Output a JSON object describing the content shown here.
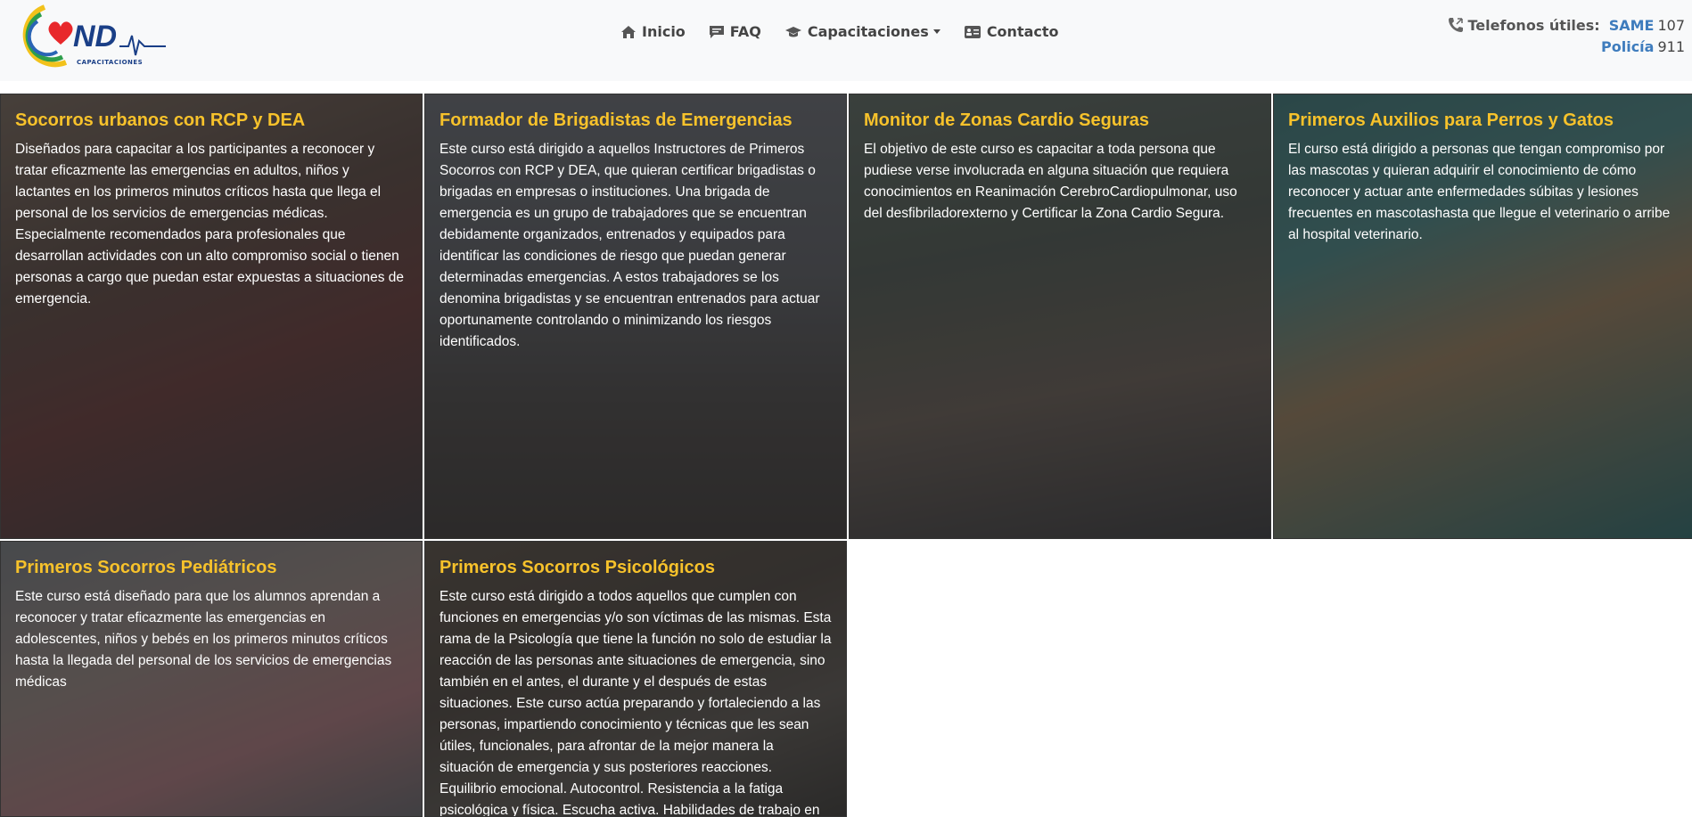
{
  "header": {
    "logo_text": "ND",
    "logo_subtext": "CAPACITACIONES",
    "nav": [
      {
        "label": "Inicio",
        "icon": "home-icon"
      },
      {
        "label": "FAQ",
        "icon": "comment-icon"
      },
      {
        "label": "Capacitaciones",
        "icon": "graduation-cap-icon"
      },
      {
        "label": "Contacto",
        "icon": "contact-card-icon"
      }
    ],
    "phones": {
      "label": "Telefonos útiles:",
      "icon": "phone-icon",
      "items": [
        {
          "service": "SAME",
          "number": "107"
        },
        {
          "service": "Policía",
          "number": "911"
        }
      ]
    }
  },
  "courses": [
    {
      "title": "Socorros urbanos con RCP y DEA",
      "text": "Diseñados para capacitar a los participantes a reconocer y tratar eficazmente las emergencias en adultos, niños y lactantes en los primeros minutos críticos hasta que llega el personal de los servicios de emergencias médicas. Especialmente recomendados para profesionales que desarrollan actividades con un alto compromiso social o tienen personas a cargo que puedan estar expuestas a situaciones de emergencia."
    },
    {
      "title": "Formador de Brigadistas de Emergencias",
      "text": "Este curso está dirigido a aquellos Instructores de Primeros Socorros con RCP y DEA, que quieran certificar brigadistas o brigadas en empresas o instituciones. Una brigada de emergencia es un grupo de trabajadores que se encuentran debidamente organizados, entrenados y equipados para identificar las condiciones de riesgo que puedan generar determinadas emergencias. A estos trabajadores se los denomina brigadistas y se encuentran entrenados para actuar oportunamente controlando o minimizando los riesgos identificados."
    },
    {
      "title": "Monitor de Zonas Cardio Seguras",
      "text": "El objetivo de este curso es capacitar a toda persona que pudiese verse involucrada en alguna situación que requiera conocimientos en Reanimación CerebroCardiopulmonar, uso del desfibriladorexterno y Certificar la Zona Cardio Segura."
    },
    {
      "title": "Primeros Auxilios para Perros y Gatos",
      "text": "El curso está dirigido a personas que tengan compromiso por las mascotas y quieran adquirir el conocimiento de cómo reconocer y actuar ante enfermedades súbitas y lesiones frecuentes en mascotashasta que llegue el veterinario o arribe al hospital veterinario."
    },
    {
      "title": "Primeros Socorros Pediátricos",
      "text": "Este curso está diseñado para que los alumnos aprendan a reconocer y tratar eficazmente las emergencias en adolescentes, niños y bebés en los primeros minutos críticos hasta la llegada del personal de los servicios de emergencias médicas"
    },
    {
      "title": "Primeros Socorros Psicológicos",
      "text": "Este curso está dirigido a todos aquellos que cumplen con funciones en emergencias y/o son víctimas de las mismas. Esta rama de la Psicología que tiene la función no solo de estudiar la reacción de las personas ante situaciones de emergencia, sino también en el antes, el durante y el después de estas situaciones. Este curso actúa preparando y fortaleciendo a las personas, impartiendo conocimiento y técnicas que les sean útiles, funcionales, para afrontar de la mejor manera la situación de emergencia y sus posteriores reacciones. Equilibrio emocional. Autocontrol. Resistencia a la fatiga psicológica y física. Escucha activa. Habilidades de trabajo en equipo."
    }
  ],
  "colors": {
    "title": "#f7c22b",
    "nav_text": "#444444",
    "service": "#3e7cbd",
    "navbar_bg": "#f8f9fa"
  }
}
